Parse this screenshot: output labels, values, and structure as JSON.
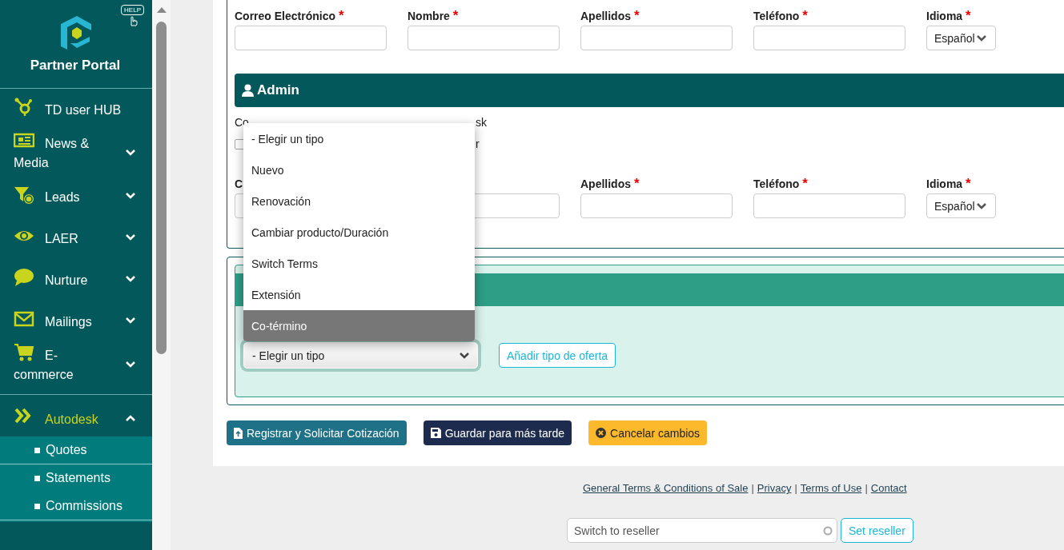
{
  "sidebar": {
    "help_label": "HELP",
    "brand": "Partner Portal",
    "items": [
      {
        "label": "TD user HUB",
        "kind": "link",
        "selected": false
      },
      {
        "label": "News & Media",
        "kind": "menu",
        "expanded": false,
        "selected": false
      },
      {
        "label": "Leads",
        "kind": "menu",
        "expanded": false,
        "selected": false
      },
      {
        "label": "LAER",
        "kind": "menu",
        "expanded": false,
        "selected": false
      },
      {
        "label": "Nurture",
        "kind": "menu",
        "expanded": false,
        "selected": false
      },
      {
        "label": "Mailings",
        "kind": "menu",
        "expanded": false,
        "selected": false
      },
      {
        "label": "E-commerce",
        "kind": "menu",
        "expanded": false,
        "selected": false
      },
      {
        "label": "Autodesk",
        "kind": "menu",
        "expanded": true,
        "selected": true,
        "children": [
          {
            "label": "Quotes"
          },
          {
            "label": "Statements"
          },
          {
            "label": "Commissions"
          }
        ]
      }
    ]
  },
  "contact_row": [
    {
      "label": "Correo Electrónico",
      "marker": "*",
      "kind": "text"
    },
    {
      "label": "Nombre",
      "marker": "*",
      "kind": "text"
    },
    {
      "label": "Apellidos",
      "marker": "*",
      "kind": "text"
    },
    {
      "label": "Teléfono",
      "marker": "*",
      "kind": "text"
    },
    {
      "label": "Idioma",
      "marker": "*",
      "kind": "select",
      "value": "Español"
    }
  ],
  "admin": {
    "title": "Admin",
    "note_parts": [
      "Co",
      "sk"
    ],
    "checkbox": {
      "checked": false,
      "label_part": "r"
    },
    "fields": [
      {
        "label": "C",
        "kind": "text"
      },
      {
        "kind": "text"
      },
      {
        "label": "Apellidos",
        "marker": "*",
        "kind": "text"
      },
      {
        "label": "Teléfono",
        "marker": "*",
        "kind": "text"
      },
      {
        "label": "Idioma",
        "marker": "*",
        "kind": "select",
        "value": "Español"
      }
    ]
  },
  "offer": {
    "select_value": "- Elegir un tipo",
    "add_button": "Añadir tipo de oferta",
    "options": [
      {
        "label": "- Elegir un tipo",
        "selected": false
      },
      {
        "label": "Nuevo",
        "selected": false
      },
      {
        "label": "Renovación",
        "selected": false
      },
      {
        "label": "Cambiar producto/Duración",
        "selected": false
      },
      {
        "label": "Switch Terms",
        "selected": false
      },
      {
        "label": "Extensión",
        "selected": false
      },
      {
        "label": "Co-término",
        "selected": true
      }
    ]
  },
  "actions": [
    {
      "label": "Registrar y Solicitar Cotización",
      "kind": "primary"
    },
    {
      "label": "Guardar para más tarde",
      "kind": "dark"
    },
    {
      "label": "Cancelar cambios",
      "kind": "warning"
    }
  ],
  "footer": {
    "links": [
      "General Terms & Conditions of Sale",
      "Privacy",
      "Terms of Use",
      "Contact"
    ],
    "separator": "|",
    "reseller_placeholder": "Switch to reseller",
    "reseller_button": "Set reseller"
  }
}
